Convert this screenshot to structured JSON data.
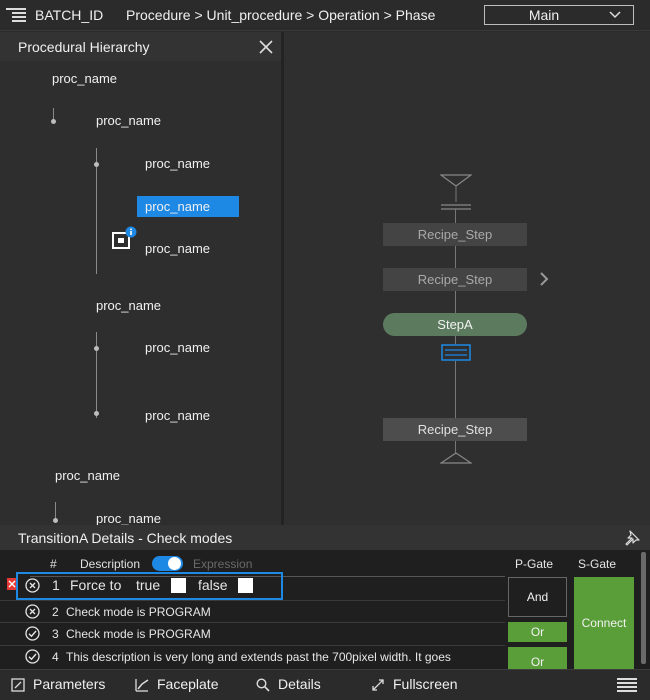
{
  "topbar": {
    "batch_id": "BATCH_ID",
    "breadcrumb": "Procedure > Unit_procedure > Operation > Phase",
    "select_value": "Main"
  },
  "hierarchy": {
    "title": "Procedural Hierarchy",
    "nodes": [
      "proc_name",
      "proc_name",
      "proc_name",
      "proc_name",
      "proc_name",
      "proc_name",
      "proc_name",
      "proc_name",
      "proc_name",
      "proc_name"
    ]
  },
  "canvas": {
    "steps": [
      "Recipe_Step",
      "Recipe_Step",
      "StepA",
      "Recipe_Step"
    ]
  },
  "details": {
    "title": "TransitionA Details - Check modes",
    "col_hash": "#",
    "col_description": "Description",
    "col_expression": "Expression",
    "rows": [
      {
        "num": "1",
        "text_a": "Force to",
        "text_b": "true",
        "text_c": "false"
      },
      {
        "num": "2",
        "text": "Check mode is PROGRAM"
      },
      {
        "num": "3",
        "text": "Check mode is PROGRAM"
      },
      {
        "num": "4",
        "text": "This description is very long and extends past the 700pixel width. It goes"
      }
    ],
    "p_gate": "P-Gate",
    "s_gate": "S-Gate",
    "and_label": "And",
    "or_label": "Or",
    "connect_label": "Connect"
  },
  "bottombar": {
    "parameters": "Parameters",
    "faceplate": "Faceplate",
    "details": "Details",
    "fullscreen": "Fullscreen"
  },
  "colors": {
    "accent": "#1e88e5",
    "gate_green": "#5a9e3a",
    "active_step": "#5c7a5e",
    "error": "#e53935"
  }
}
